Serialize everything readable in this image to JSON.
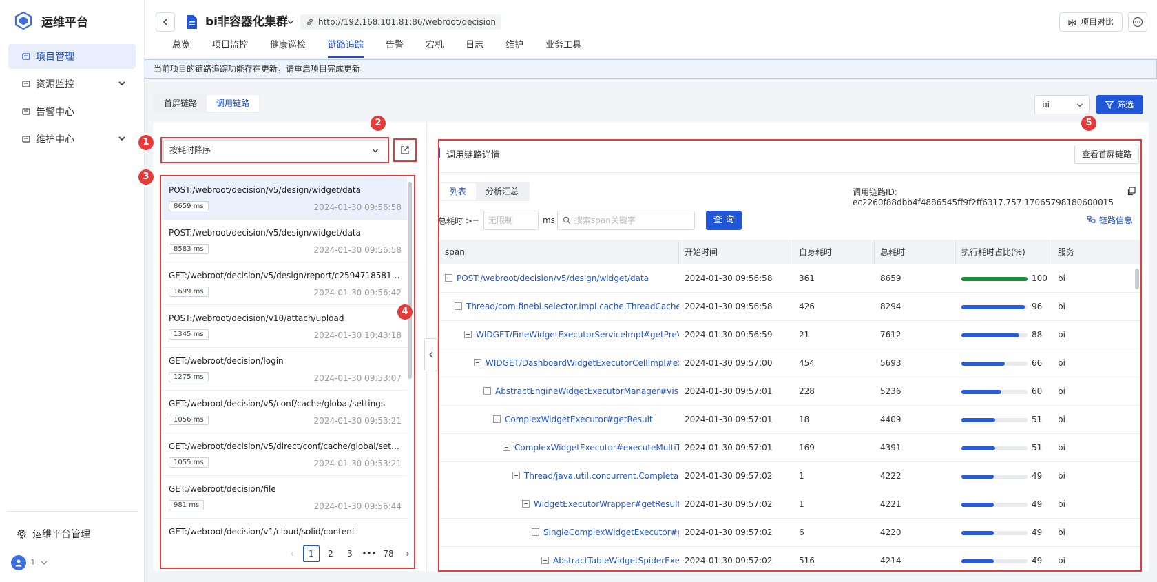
{
  "brand": {
    "name": "运维平台"
  },
  "sidebar": {
    "items": [
      {
        "label": "项目管理",
        "active": true
      },
      {
        "label": "资源监控",
        "expandable": true
      },
      {
        "label": "告警中心"
      },
      {
        "label": "维护中心",
        "expandable": true
      }
    ],
    "admin_label": "运维平台管理",
    "user_label": "1"
  },
  "header": {
    "title": "bi非容器化集群",
    "url": "http://192.168.101.81:86/webroot/decision",
    "compare_label": "项目对比",
    "tabs": [
      "总览",
      "项目监控",
      "健康巡检",
      "链路追踪",
      "告警",
      "宕机",
      "日志",
      "维护",
      "业务工具"
    ],
    "active_tab": 3
  },
  "notice": "当前项目的链路追踪功能存在更新，请重启项目完成更新",
  "toolbar": {
    "seg": [
      "首屏链路",
      "调用链路"
    ],
    "seg_active": 1,
    "service_select": "bi",
    "filter_label": "筛选"
  },
  "left": {
    "sort_label": "按耗时降序",
    "requests": [
      {
        "path": "POST:/webroot/decision/v5/design/widget/data",
        "ms": "8659 ms",
        "time": "2024-01-30 09:56:58",
        "active": true
      },
      {
        "path": "POST:/webroot/decision/v5/design/widget/data",
        "ms": "8583 ms",
        "time": "2024-01-30 09:56:58"
      },
      {
        "path": "GET:/webroot/decision/v5/design/report/c2594718581f493f...",
        "ms": "1699 ms",
        "time": "2024-01-30 09:56:42"
      },
      {
        "path": "POST:/webroot/decision/v10/attach/upload",
        "ms": "1345 ms",
        "time": "2024-01-30 10:43:18"
      },
      {
        "path": "GET:/webroot/decision/login",
        "ms": "1275 ms",
        "time": "2024-01-30 09:53:07"
      },
      {
        "path": "GET:/webroot/decision/v5/conf/cache/global/settings",
        "ms": "1056 ms",
        "time": "2024-01-30 09:53:21"
      },
      {
        "path": "GET:/webroot/decision/v5/direct/conf/cache/global/settings",
        "ms": "1055 ms",
        "time": "2024-01-30 09:53:21"
      },
      {
        "path": "GET:/webroot/decision/file",
        "ms": "981 ms",
        "time": "2024-01-30 09:56:44"
      },
      {
        "path": "GET:/webroot/decision/v1/cloud/solid/content",
        "ms": "",
        "time": ""
      }
    ],
    "pager": {
      "pages": [
        "1",
        "2",
        "3",
        "•••",
        "78"
      ],
      "current": "1"
    }
  },
  "badges": [
    "1",
    "2",
    "3",
    "4",
    "5"
  ],
  "detail": {
    "title": "调用链路详情",
    "first_screen_btn": "查看首屏链路",
    "view_tabs": [
      "列表",
      "分析汇总"
    ],
    "view_active": 0,
    "trace_id": "调用链路ID: ec2260f88dbb4f4886545ff9f2ff6317.757.17065798180600015",
    "filter_label": "总耗时 >=",
    "min_placeholder": "无限制",
    "unit": "ms",
    "search_placeholder": "搜索span关键字",
    "query_label": "查 询",
    "link_info_label": "链路信息",
    "columns": [
      "span",
      "开始时间",
      "自身耗时",
      "总耗时",
      "执行耗时占比(%)",
      "服务"
    ],
    "rows": [
      {
        "span": "POST:/webroot/decision/v5/design/widget/data",
        "start": "2024-01-30 09:56:58",
        "self": "361",
        "total": "8659",
        "pct": 100,
        "service": "bi",
        "indent": 0
      },
      {
        "span": "Thread/com.finebi.selector.impl.cache.ThreadCache$$Lambda",
        "start": "2024-01-30 09:56:58",
        "self": "426",
        "total": "8294",
        "pct": 96,
        "service": "bi",
        "indent": 1
      },
      {
        "span": "WIDGET/FineWidgetExecutorServiceImpl#getPreViewResult",
        "start": "2024-01-30 09:56:59",
        "self": "21",
        "total": "7612",
        "pct": 88,
        "service": "bi",
        "indent": 2
      },
      {
        "span": "WIDGET/DashboardWidgetExecutorCellImpl#execute",
        "start": "2024-01-30 09:57:00",
        "self": "454",
        "total": "5693",
        "pct": 66,
        "service": "bi",
        "indent": 3
      },
      {
        "span": "AbstractEngineWidgetExecutorManager#visit",
        "start": "2024-01-30 09:57:01",
        "self": "228",
        "total": "5236",
        "pct": 60,
        "service": "bi",
        "indent": 4
      },
      {
        "span": "ComplexWidgetExecutor#getResult",
        "start": "2024-01-30 09:57:01",
        "self": "18",
        "total": "4409",
        "pct": 51,
        "service": "bi",
        "indent": 5
      },
      {
        "span": "ComplexWidgetExecutor#executeMultiThread",
        "start": "2024-01-30 09:57:01",
        "self": "169",
        "total": "4391",
        "pct": 51,
        "service": "bi",
        "indent": 6
      },
      {
        "span": "Thread/java.util.concurrent.CompletableFuture",
        "start": "2024-01-30 09:57:02",
        "self": "1",
        "total": "4222",
        "pct": 49,
        "service": "bi",
        "indent": 7
      },
      {
        "span": "WidgetExecutorWrapper#getResult",
        "start": "2024-01-30 09:57:02",
        "self": "1",
        "total": "4221",
        "pct": 49,
        "service": "bi",
        "indent": 8
      },
      {
        "span": "SingleComplexWidgetExecutor#getResult",
        "start": "2024-01-30 09:57:02",
        "self": "6",
        "total": "4220",
        "pct": 49,
        "service": "bi",
        "indent": 9
      },
      {
        "span": "AbstractTableWidgetSpiderExecutor",
        "start": "2024-01-30 09:57:02",
        "self": "516",
        "total": "4214",
        "pct": 49,
        "service": "bi",
        "indent": 10
      }
    ]
  },
  "colors": {
    "accent": "#2156d9",
    "annotation": "#e43a3a",
    "full_bar": "#1f8f3a",
    "bar": "#2a5bd7"
  }
}
